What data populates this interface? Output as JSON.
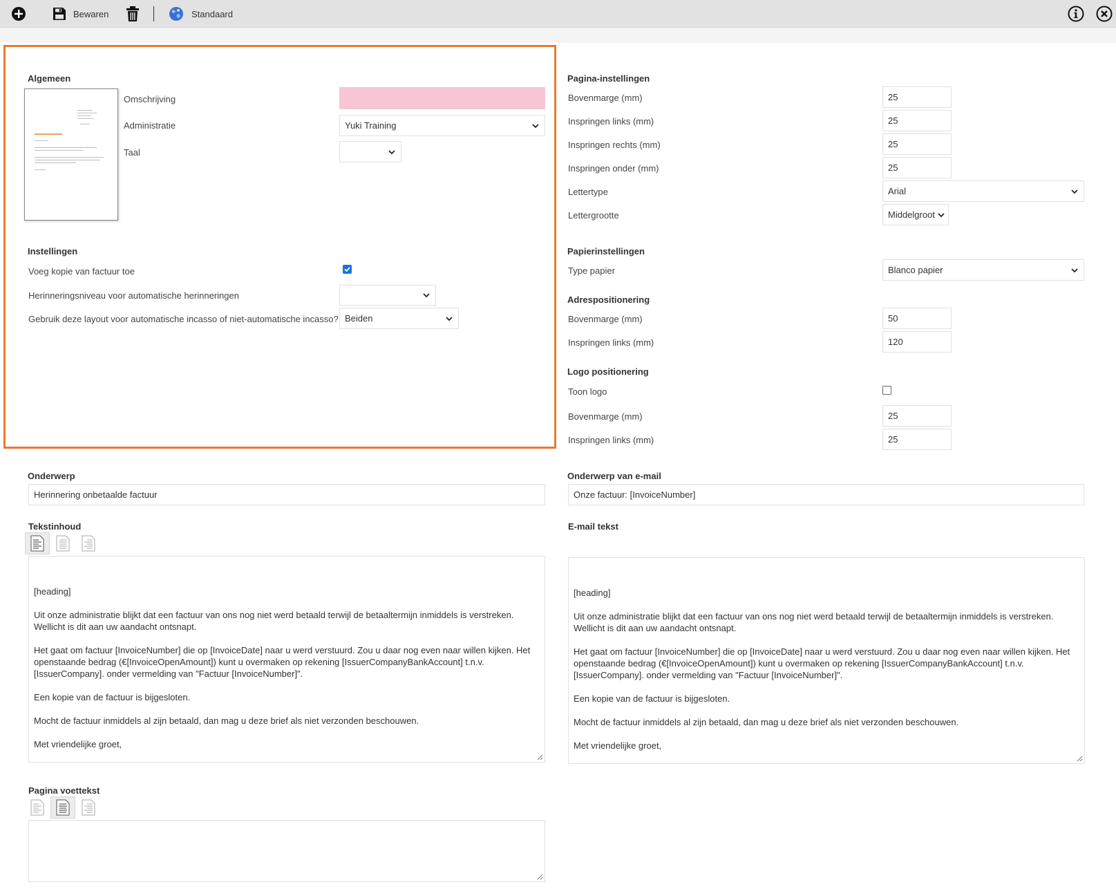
{
  "toolbar": {
    "bewaren_label": "Bewaren",
    "standaard_label": "Standaard"
  },
  "algemeen": {
    "title": "Algemeen",
    "omschrijving_label": "Omschrijving",
    "omschrijving_value": "",
    "administratie_label": "Administratie",
    "administratie_value": "Yuki Training",
    "taal_label": "Taal",
    "taal_value": ""
  },
  "instellingen": {
    "title": "Instellingen",
    "kopie_label": "Voeg kopie van factuur toe",
    "kopie_checked": true,
    "niveau_label": "Herinneringsniveau voor automatische herinneringen",
    "niveau_value": "",
    "incasso_label": "Gebruik deze layout voor automatische incasso of niet-automatische incasso?",
    "incasso_value": "Beiden"
  },
  "pagina": {
    "title": "Pagina-instellingen",
    "bovenmarge_label": "Bovenmarge (mm)",
    "bovenmarge_value": "25",
    "links_label": "Inspringen links (mm)",
    "links_value": "25",
    "rechts_label": "Inspringen rechts (mm)",
    "rechts_value": "25",
    "onder_label": "Inspringen onder (mm)",
    "onder_value": "25",
    "lettertype_label": "Lettertype",
    "lettertype_value": "Arial",
    "lettergrootte_label": "Lettergrootte",
    "lettergrootte_value": "Middelgroot"
  },
  "papier": {
    "title": "Papierinstellingen",
    "type_label": "Type papier",
    "type_value": "Blanco papier"
  },
  "adres": {
    "title": "Adrespositionering",
    "bovenmarge_label": "Bovenmarge (mm)",
    "bovenmarge_value": "50",
    "links_label": "Inspringen links (mm)",
    "links_value": "120"
  },
  "logo": {
    "title": "Logo positionering",
    "toon_label": "Toon logo",
    "toon_checked": false,
    "bovenmarge_label": "Bovenmarge (mm)",
    "bovenmarge_value": "25",
    "links_label": "Inspringen links (mm)",
    "links_value": "25"
  },
  "onderwerp": {
    "title": "Onderwerp",
    "value": "Herinnering onbetaalde factuur"
  },
  "email_onderwerp": {
    "title": "Onderwerp van e-mail",
    "value": "Onze factuur: [InvoiceNumber]"
  },
  "tekstinhoud": {
    "title": "Tekstinhoud",
    "body": "[heading]\n\nUit onze administratie blijkt dat een factuur van ons nog niet werd betaald terwijl de betaaltermijn inmiddels is verstreken.\nWellicht is dit aan uw aandacht ontsnapt.\n\nHet gaat om factuur [InvoiceNumber] die op [InvoiceDate] naar u werd verstuurd. Zou u daar nog even naar willen kijken. Het\nopenstaande bedrag (€[InvoiceOpenAmount]) kunt u overmaken op rekening [IssuerCompanyBankAccount] t.n.v.\n[IssuerCompany]. onder vermelding van \"Factuur [InvoiceNumber]\".\n\nEen kopie van de factuur is bijgesloten.\n\nMocht de factuur inmiddels al zijn betaald, dan mag u deze brief als niet verzonden beschouwen.\n\nMet vriendelijke groet,\n\n[IssuerCompany]"
  },
  "email_tekst": {
    "title": "E-mail tekst",
    "body": "[heading]\n\nUit onze administratie blijkt dat een factuur van ons nog niet werd betaald terwijl de betaaltermijn inmiddels is verstreken.\nWellicht is dit aan uw aandacht ontsnapt.\n\nHet gaat om factuur [InvoiceNumber] die op [InvoiceDate] naar u werd verstuurd. Zou u daar nog even naar willen kijken. Het\nopenstaande bedrag (€[InvoiceOpenAmount]) kunt u overmaken op rekening [IssuerCompanyBankAccount] t.n.v.\n[IssuerCompany]. onder vermelding van \"Factuur [InvoiceNumber]\".\n\nEen kopie van de factuur is bijgesloten.\n\nMocht de factuur inmiddels al zijn betaald, dan mag u deze brief als niet verzonden beschouwen.\n\nMet vriendelijke groet,\n\n[IssuerCompany]"
  },
  "voettekst": {
    "title": "Pagina voettekst",
    "body": ""
  },
  "icons": {
    "add": "plus-circle-icon",
    "save": "floppy-disk-icon",
    "delete": "trash-icon",
    "default": "globe-icon",
    "info": "info-circle-icon",
    "close": "close-circle-icon",
    "align_left": "align-left-icon",
    "align_center": "align-center-icon",
    "align_right": "align-right-icon"
  },
  "colors": {
    "highlight_border": "#e87a2e",
    "required_field": "#f7c6d4",
    "checkbox_checked": "#1a73e8",
    "toolbar_bg": "#e2e2e2"
  }
}
